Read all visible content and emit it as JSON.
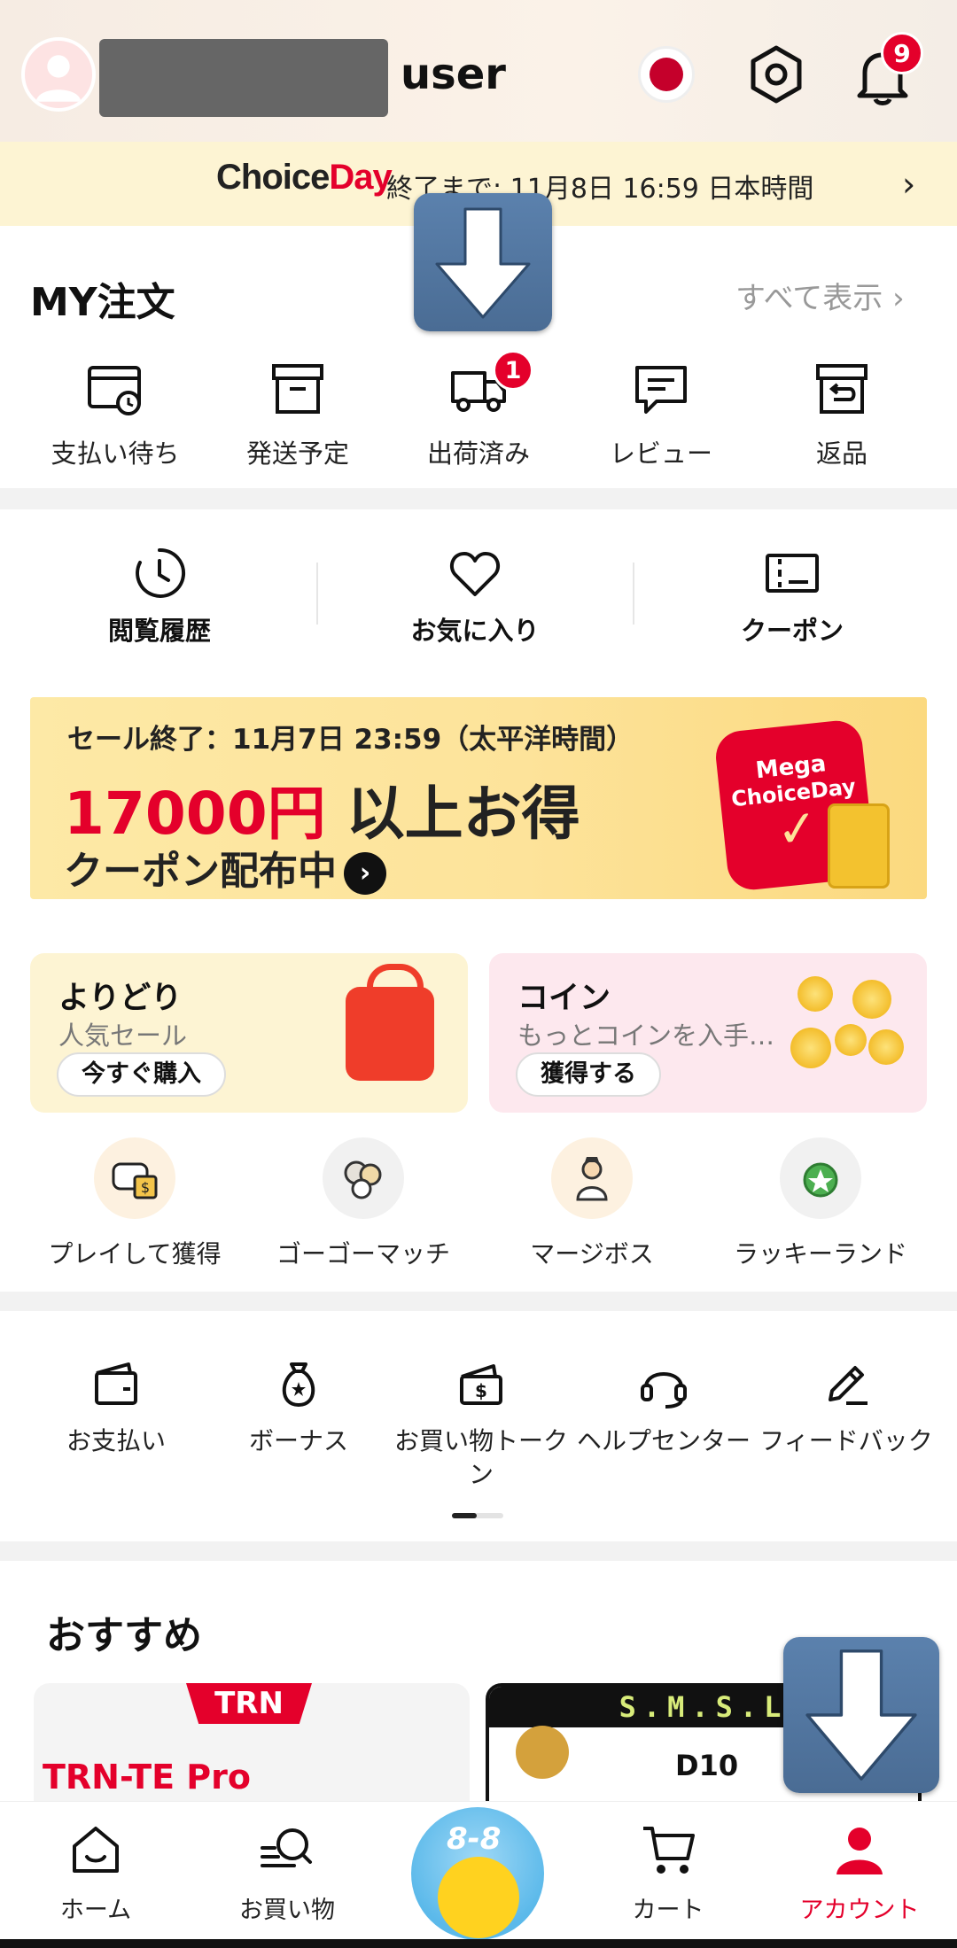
{
  "header": {
    "username": "user",
    "notification_count": "9"
  },
  "choice_bar": {
    "logo_part1": "Choice",
    "logo_part2": "Day",
    "text": "終了まで:  11月8日 16:59 日本時間"
  },
  "orders": {
    "title": "MY注文",
    "view_all": "すべて表示 ›",
    "items": [
      {
        "label": "支払い待ち",
        "icon": "wallet-clock-icon"
      },
      {
        "label": "発送予定",
        "icon": "box-icon"
      },
      {
        "label": "出荷済み",
        "icon": "truck-icon",
        "badge": "1"
      },
      {
        "label": "レビュー",
        "icon": "message-icon"
      },
      {
        "label": "返品",
        "icon": "return-icon"
      }
    ]
  },
  "quick": {
    "items": [
      {
        "label": "閲覧履歴",
        "icon": "clock-icon"
      },
      {
        "label": "お気に入り",
        "icon": "heart-icon"
      },
      {
        "label": "クーポン",
        "icon": "coupon-icon"
      }
    ]
  },
  "promo": {
    "line1": "セール終了：11月7日 23:59（太平洋時間）",
    "amount": "17000円",
    "amount_suffix": " 以上お得",
    "line3": "クーポン配布中",
    "badge_line1": "Mega",
    "badge_line2": "ChoiceDay"
  },
  "tiles": {
    "yoridori": {
      "title": "よりどり",
      "subtitle": "人気セール",
      "button": "今すぐ購入"
    },
    "coin": {
      "title": "コイン",
      "subtitle": "もっとコインを入手…",
      "button": "獲得する"
    }
  },
  "games": [
    {
      "label": "プレイして獲得",
      "icon": "game-coin-icon"
    },
    {
      "label": "ゴーゴーマッチ",
      "icon": "match-icon"
    },
    {
      "label": "マージボス",
      "icon": "merge-boss-icon"
    },
    {
      "label": "ラッキーランド",
      "icon": "lucky-land-icon"
    }
  ],
  "services": [
    {
      "label": "お支払い",
      "icon": "wallet-icon"
    },
    {
      "label": "ボーナス",
      "icon": "bonus-bag-icon"
    },
    {
      "label": "お買い物トークン",
      "icon": "token-icon"
    },
    {
      "label": "ヘルプセンター",
      "icon": "headset-icon"
    },
    {
      "label": "フィードバック",
      "icon": "pencil-icon"
    }
  ],
  "recommend": {
    "title": "おすすめ",
    "products": [
      {
        "brand": "TRN",
        "name": "TRN-TE Pro"
      },
      {
        "brand": "S.M.S.L",
        "name": "D10"
      }
    ]
  },
  "nav": {
    "items": [
      {
        "label": "ホーム",
        "icon": "home-icon"
      },
      {
        "label": "お買い物",
        "icon": "search-icon"
      },
      {
        "label": "カート",
        "icon": "cart-icon"
      },
      {
        "label": "アカウント",
        "icon": "account-icon"
      }
    ],
    "center_text": "8-8"
  },
  "colors": {
    "accent": "#e4002b",
    "choice_bar_bg": "#fdf4d3",
    "overlay_arrow": "#4f7299"
  }
}
